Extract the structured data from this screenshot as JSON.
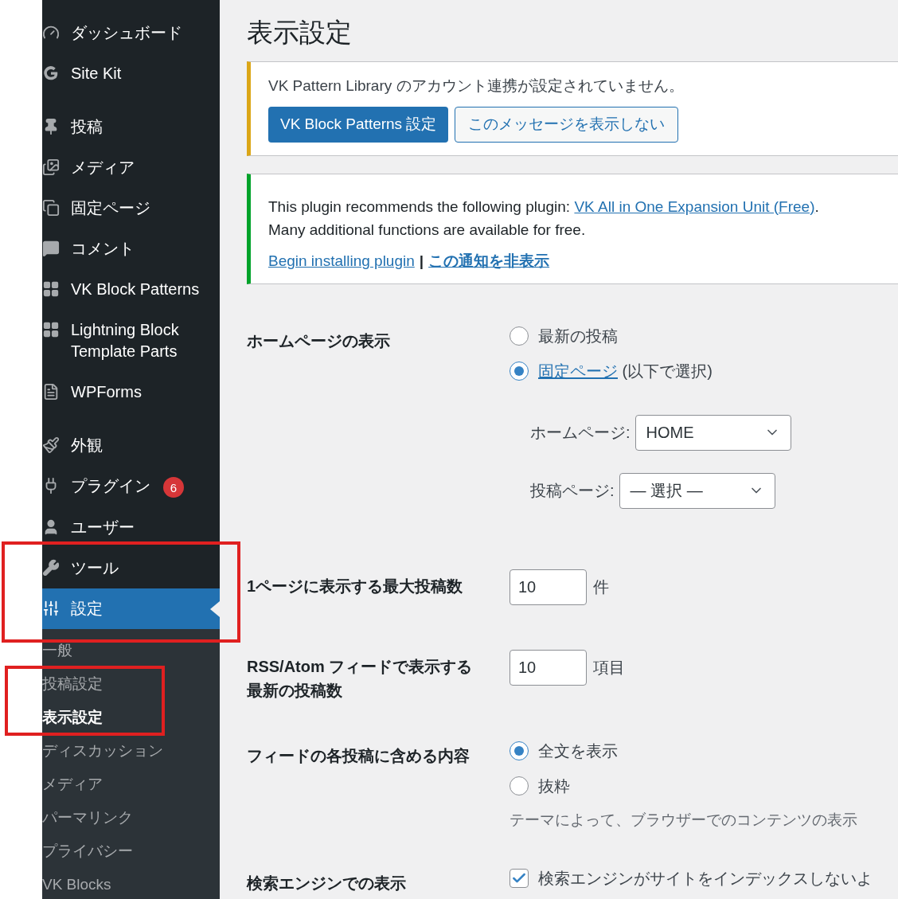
{
  "sidebar": {
    "menu": [
      {
        "label": "ダッシュボード",
        "selected": false,
        "gap_after": false
      },
      {
        "label": "Site Kit",
        "selected": false,
        "gap_after": true
      },
      {
        "label": "投稿",
        "selected": false,
        "gap_after": false
      },
      {
        "label": "メディア",
        "selected": false,
        "gap_after": false
      },
      {
        "label": "固定ページ",
        "selected": false,
        "gap_after": false
      },
      {
        "label": "コメント",
        "selected": false,
        "gap_after": false
      },
      {
        "label": "VK Block Patterns",
        "selected": false,
        "gap_after": false
      },
      {
        "label": "Lightning Block Template Parts",
        "selected": false,
        "gap_after": false
      },
      {
        "label": "WPForms",
        "selected": false,
        "gap_after": true
      },
      {
        "label": "外観",
        "selected": false,
        "gap_after": false
      },
      {
        "label": "プラグイン",
        "selected": false,
        "gap_after": false,
        "badge": "6"
      },
      {
        "label": "ユーザー",
        "selected": false,
        "gap_after": false
      },
      {
        "label": "ツール",
        "selected": false,
        "gap_after": false
      },
      {
        "label": "設定",
        "selected": true,
        "gap_after": false
      }
    ],
    "submenu": [
      {
        "label": "一般",
        "selected": false
      },
      {
        "label": "投稿設定",
        "selected": false
      },
      {
        "label": "表示設定",
        "selected": true
      },
      {
        "label": "ディスカッション",
        "selected": false
      },
      {
        "label": "メディア",
        "selected": false
      },
      {
        "label": "パーマリンク",
        "selected": false
      },
      {
        "label": "プライバシー",
        "selected": false
      },
      {
        "label": "VK Blocks",
        "selected": false
      }
    ]
  },
  "page_title": "表示設定",
  "notices": [
    {
      "kind": "warning",
      "message": "VK Pattern Library のアカウント連携が設定されていません。",
      "primary_button": "VK Block Patterns 設定",
      "secondary_button": "このメッセージを表示しない"
    },
    {
      "kind": "success",
      "message": "This plugin recommends the following plugin: ",
      "message_link": "VK All in One Expansion Unit (Free)",
      "message_end": ".",
      "message_line2": "Many additional functions are available for free.",
      "link_1": "Begin installing plugin",
      "separator": "|",
      "link_2": "この通知を非表示"
    }
  ],
  "settings": [
    {
      "kind": "radio-group",
      "label": "ホームページの表示",
      "options": [
        {
          "label": "最新の投稿",
          "selected": false
        },
        {
          "label_link": "固定ページ",
          "label": " (以下で選択)",
          "selected": true
        }
      ],
      "selects": [
        {
          "label": "ホームページ:",
          "value": "HOME"
        },
        {
          "label": "投稿ページ:",
          "value": "— 選択 —"
        }
      ]
    },
    {
      "kind": "number",
      "label": "1ページに表示する最大投稿数",
      "value": "10",
      "unit": "件"
    },
    {
      "kind": "number",
      "label": "RSS/Atom フィードで表示する最新の投稿数",
      "value": "10",
      "unit": "項目"
    },
    {
      "kind": "radio-group",
      "label": "フィードの各投稿に含める内容",
      "options": [
        {
          "label": "全文を表示",
          "selected": true
        },
        {
          "label": "抜粋",
          "selected": false
        }
      ],
      "description": "テーマによって、ブラウザーでのコンテンツの表示"
    },
    {
      "kind": "checkbox",
      "label": "検索エンジンでの表示",
      "option": "検索エンジンがサイトをインデックスしないよ",
      "checked": true
    }
  ],
  "annotations": [
    {
      "kind": "frame"
    },
    {
      "kind": "frame"
    }
  ]
}
